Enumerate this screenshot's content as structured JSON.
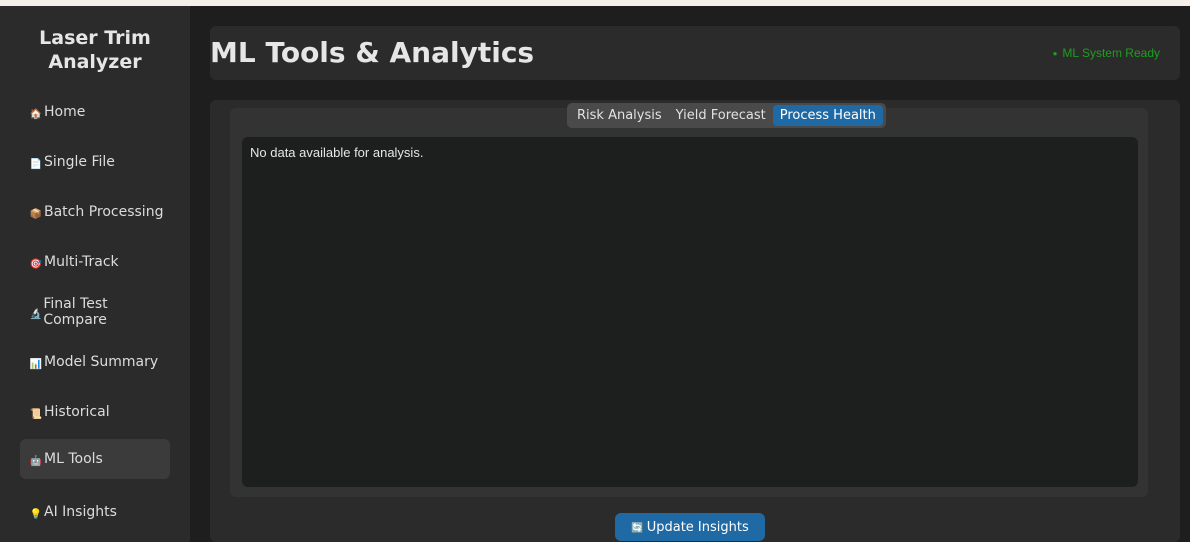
{
  "sidebar": {
    "app_title_line1": "Laser Trim",
    "app_title_line2": "Analyzer",
    "items": [
      {
        "icon": "house-icon",
        "glyph": "🏠",
        "label": "Home"
      },
      {
        "icon": "document-icon",
        "glyph": "📄",
        "label": "Single File"
      },
      {
        "icon": "package-icon",
        "glyph": "📦",
        "label": "Batch Processing"
      },
      {
        "icon": "target-icon",
        "glyph": "🎯",
        "label": "Multi-Track"
      },
      {
        "icon": "microscope-icon",
        "glyph": "🔬",
        "label": "Final Test Compare"
      },
      {
        "icon": "chart-icon",
        "glyph": "📊",
        "label": "Model Summary"
      },
      {
        "icon": "scroll-icon",
        "glyph": "📜",
        "label": "Historical"
      },
      {
        "icon": "robot-icon",
        "glyph": "🤖",
        "label": "ML Tools"
      },
      {
        "icon": "lightbulb-icon",
        "glyph": "💡",
        "label": "AI Insights"
      }
    ],
    "active_item": "ML Tools"
  },
  "header": {
    "title": "ML Tools & Analytics",
    "status_text": "ML System Ready",
    "status_color": "#1f9e1f"
  },
  "tabs": {
    "items": [
      "Risk Analysis",
      "Yield Forecast",
      "Process Health"
    ],
    "selected": "Process Health"
  },
  "content": {
    "message": "No data available for analysis."
  },
  "actions": {
    "update_label": "Update Insights",
    "update_icon": "refresh-icon"
  },
  "colors": {
    "accent": "#1f6aa5",
    "sidebar_bg": "#2b2b2b",
    "page_bg": "#1e1e1e"
  }
}
